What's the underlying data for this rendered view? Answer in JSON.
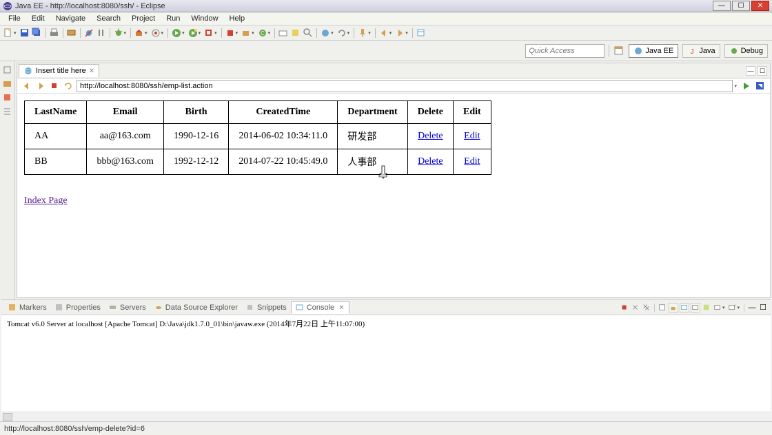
{
  "titlebar": {
    "text": "Java EE - http://localhost:8080/ssh/ - Eclipse"
  },
  "menus": [
    "File",
    "Edit",
    "Navigate",
    "Search",
    "Project",
    "Run",
    "Window",
    "Help"
  ],
  "quick_access_placeholder": "Quick Access",
  "perspectives": {
    "javaee": "Java EE",
    "java": "Java",
    "debug": "Debug"
  },
  "editor_tab": {
    "title": "Insert title here"
  },
  "browser": {
    "url": "http://localhost:8080/ssh/emp-list.action"
  },
  "table": {
    "headers": [
      "LastName",
      "Email",
      "Birth",
      "CreatedTime",
      "Department",
      "Delete",
      "Edit"
    ],
    "rows": [
      {
        "lastname": "AA",
        "email": "aa@163.com",
        "birth": "1990-12-16",
        "created": "2014-06-02 10:34:11.0",
        "dept": "研发部",
        "del": "Delete",
        "edit": "Edit"
      },
      {
        "lastname": "BB",
        "email": "bbb@163.com",
        "birth": "1992-12-12",
        "created": "2014-07-22 10:45:49.0",
        "dept": "人事部",
        "del": "Delete",
        "edit": "Edit"
      }
    ]
  },
  "index_link": "Index Page",
  "bottom_tabs": {
    "markers": "Markers",
    "properties": "Properties",
    "servers": "Servers",
    "dse": "Data Source Explorer",
    "snippets": "Snippets",
    "console": "Console"
  },
  "console_text": "Tomcat v6.0 Server at localhost [Apache Tomcat] D:\\Java\\jdk1.7.0_01\\bin\\javaw.exe (2014年7月22日 上午11:07:00)",
  "statusbar": {
    "text": "http://localhost:8080/ssh/emp-delete?id=6"
  }
}
